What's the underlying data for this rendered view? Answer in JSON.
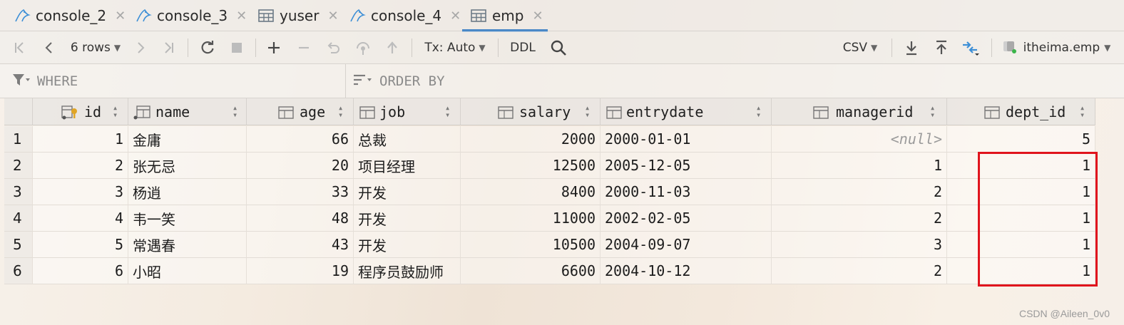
{
  "tabs": [
    {
      "label": "console_2",
      "icon": "mysql-console-icon",
      "active": false
    },
    {
      "label": "console_3",
      "icon": "mysql-console-icon",
      "active": false
    },
    {
      "label": "yuser",
      "icon": "table-icon",
      "active": false
    },
    {
      "label": "console_4",
      "icon": "mysql-console-icon",
      "active": false
    },
    {
      "label": "emp",
      "icon": "table-icon",
      "active": true
    }
  ],
  "toolbar": {
    "rows_label": "6 rows",
    "tx_label": "Tx: Auto",
    "ddl_label": "DDL",
    "csv_label": "CSV",
    "datasource_label": "itheima.emp"
  },
  "filters": {
    "where_label": "WHERE",
    "orderby_label": "ORDER BY"
  },
  "columns": [
    "id",
    "name",
    "age",
    "job",
    "salary",
    "entrydate",
    "managerid",
    "dept_id"
  ],
  "rows": [
    {
      "rownum": "1",
      "id": "1",
      "name": "金庸",
      "age": "66",
      "job": "总裁",
      "salary": "2000",
      "entrydate": "2000-01-01",
      "managerid": "<null>",
      "dept_id": "5"
    },
    {
      "rownum": "2",
      "id": "2",
      "name": "张无忌",
      "age": "20",
      "job": "项目经理",
      "salary": "12500",
      "entrydate": "2005-12-05",
      "managerid": "1",
      "dept_id": "1"
    },
    {
      "rownum": "3",
      "id": "3",
      "name": "杨逍",
      "age": "33",
      "job": "开发",
      "salary": "8400",
      "entrydate": "2000-11-03",
      "managerid": "2",
      "dept_id": "1"
    },
    {
      "rownum": "4",
      "id": "4",
      "name": "韦一笑",
      "age": "48",
      "job": "开发",
      "salary": "11000",
      "entrydate": "2002-02-05",
      "managerid": "2",
      "dept_id": "1"
    },
    {
      "rownum": "5",
      "id": "5",
      "name": "常遇春",
      "age": "43",
      "job": "开发",
      "salary": "10500",
      "entrydate": "2004-09-07",
      "managerid": "3",
      "dept_id": "1"
    },
    {
      "rownum": "6",
      "id": "6",
      "name": "小昭",
      "age": "19",
      "job": "程序员鼓励师",
      "salary": "6600",
      "entrydate": "2004-10-12",
      "managerid": "2",
      "dept_id": "1"
    }
  ],
  "watermark": "CSDN @Aileen_0v0",
  "colors": {
    "accent": "#4a88c7",
    "highlight": "#e0141d",
    "link_blue": "#3d8fd6"
  }
}
